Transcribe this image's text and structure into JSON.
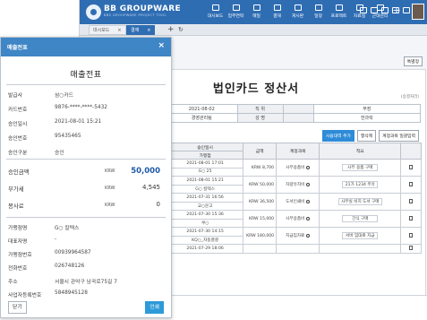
{
  "app": {
    "brand": "BB GROUPWARE",
    "brand_sub": "BBS GROUPWARE PROJECT TOOL",
    "nav": [
      {
        "label": "대시보드",
        "icon": "dashboard-icon"
      },
      {
        "label": "업무연락",
        "icon": "mail-icon"
      },
      {
        "label": "메일",
        "icon": "envelope-icon"
      },
      {
        "label": "결재",
        "icon": "approval-icon"
      },
      {
        "label": "게시판",
        "icon": "board-icon"
      },
      {
        "label": "일정",
        "icon": "calendar-icon"
      },
      {
        "label": "프로젝트",
        "icon": "project-icon"
      },
      {
        "label": "자료실",
        "icon": "folder-icon"
      },
      {
        "label": "근태관리",
        "icon": "clock-icon"
      }
    ],
    "nav_add": "+",
    "accent": "#2f6db3"
  },
  "tabs": {
    "items": [
      {
        "label": "대시보드",
        "close": "×"
      },
      {
        "label": "결재",
        "close": "×"
      }
    ],
    "add": "+"
  },
  "form": {
    "special_button": "특별정",
    "title": "법인카드 정산서",
    "subtitle": "(승결처리)",
    "info": {
      "date": "2021-08-02",
      "dept_label": "직 위",
      "dept_value": "부장",
      "team": "경영관리팀",
      "name_label": "성 명",
      "name_value": "한과락"
    },
    "actions": [
      "사용대역 추가",
      "행삭제",
      "계정과목 일괄입력"
    ],
    "table": {
      "headers": [
        "승인일시",
        "가맹점",
        "금액",
        "계정과목",
        "적요"
      ],
      "rows": [
        {
          "datetime": "2021-08-01 17:01",
          "merchant": "G○ 25",
          "cur": "KRW",
          "amount": "8,700",
          "account": "사무용품비",
          "memo": "사무 용품 구매"
        },
        {
          "datetime": "2021-08-01 15:21",
          "merchant": "G○ 칼텍스",
          "cur": "KRW",
          "amount": "50,000",
          "account": "차량유지비",
          "memo": "21가 1234 주유"
        },
        {
          "datetime": "2021-07-31 16:56",
          "merchant": "교○문고",
          "cur": "KRW",
          "amount": "36,500",
          "account": "도서인쇄비",
          "memo": "사무실 비치 도서 구매"
        },
        {
          "datetime": "2021-07-30 15:36",
          "merchant": "쿠○",
          "cur": "KRW",
          "amount": "15,000",
          "account": "사무용품비",
          "memo": "간식 구매"
        },
        {
          "datetime": "2021-07-30 14:15",
          "merchant": "KQ○_자동결결",
          "cur": "KRW",
          "amount": "180,000",
          "account": "지급임차료",
          "memo": "서버 임대료 지급"
        },
        {
          "datetime": "2021-07-29 18:06",
          "merchant": "",
          "cur": "",
          "amount": "",
          "account": "",
          "memo": ""
        }
      ]
    }
  },
  "modal": {
    "title": "매출전표",
    "close": "×",
    "receipt_title": "매출전표",
    "issuer_label": "발급사",
    "issuer": "삼○카드",
    "fields": [
      {
        "label": "카드번호",
        "value": "9876-****-****-5432"
      },
      {
        "label": "승인일시",
        "value": "2021-08-01 15:21"
      },
      {
        "label": "승인번호",
        "value": "95435465"
      },
      {
        "label": "승인구분",
        "value": "승인"
      }
    ],
    "amounts": [
      {
        "label": "승인금액",
        "currency": "KRW",
        "value": "50,000"
      },
      {
        "label": "부가세",
        "currency": "KRW",
        "value": "4,545"
      },
      {
        "label": "봉사료",
        "currency": "KRW",
        "value": "0"
      }
    ],
    "merchant": [
      {
        "label": "가맹점명",
        "value": "G○ 칼텍스"
      },
      {
        "label": "대표자명",
        "value": "-"
      },
      {
        "label": "가맹점번호",
        "value": "00939964587"
      },
      {
        "label": "전화번호",
        "value": "026748126"
      },
      {
        "label": "주소",
        "value": "서울시 관악구 남곡로75길 7"
      },
      {
        "label": "사업자등록번호",
        "value": "5848945128"
      }
    ],
    "close_button": "닫기",
    "print_button": "인쇄"
  }
}
